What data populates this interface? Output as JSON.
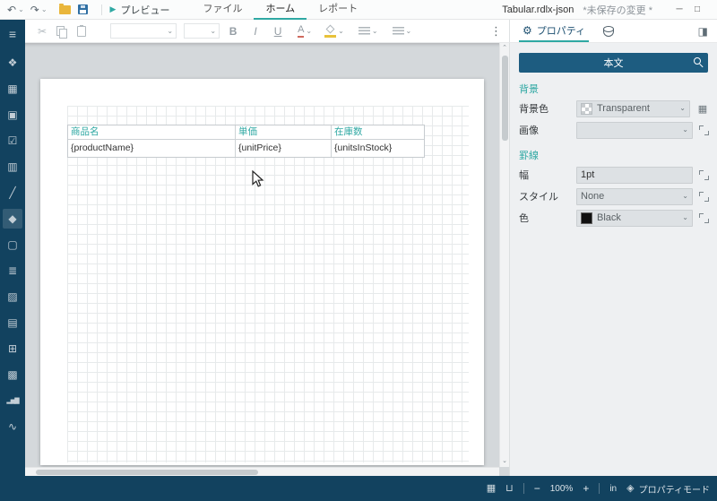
{
  "colors": {
    "accent_teal": "#2fa8a3",
    "sidebar_navy": "#12425f",
    "selector_blue": "#1d5c80",
    "canvas_gray": "#d4d8db",
    "save_blue": "#2f6fa3",
    "folder_yellow": "#e9b63b",
    "swatch_black": "#111111"
  },
  "glyphs": {
    "undo": "↶",
    "redo": "↷",
    "caret": "⌄",
    "play": "▶",
    "scissors": "✂",
    "dots": "⋮",
    "gear": "⚙",
    "panel_right": "◨",
    "minimize": "─",
    "maximize": "□",
    "grid_small": "▦",
    "page_view": "⊔",
    "layers": "◈",
    "scroll_up": "⌃",
    "scroll_down": "⌄"
  },
  "titlebar": {
    "preview_label": "プレビュー",
    "tabs": [
      {
        "label": "ファイル"
      },
      {
        "label": "ホーム",
        "active": true
      },
      {
        "label": "レポート"
      }
    ],
    "document_name": "Tabular.rdlx-json",
    "unsaved_indicator": "*未保存の変更 *"
  },
  "toolbar": {
    "bold": "B",
    "italic": "I",
    "underline": "U",
    "font_color": "A"
  },
  "panel_header": {
    "properties_tab": "プロパティ"
  },
  "sidebar": {
    "items": [
      {
        "name": "hamburger-menu-icon",
        "glyph": "≡"
      },
      {
        "name": "toolbox-shape-icon",
        "glyph": "❖"
      },
      {
        "name": "toolbox-tablix-icon",
        "glyph": "▦"
      },
      {
        "name": "toolbox-image-icon",
        "glyph": "▣"
      },
      {
        "name": "toolbox-checkbox-icon",
        "glyph": "☑"
      },
      {
        "name": "toolbox-barcode-icon",
        "glyph": "▥"
      },
      {
        "name": "toolbox-line-icon",
        "glyph": "╱"
      },
      {
        "name": "toolbox-ellipse-icon",
        "glyph": "◆"
      },
      {
        "name": "toolbox-container-icon",
        "glyph": "▢"
      },
      {
        "name": "toolbox-textbox-icon",
        "glyph": "≣"
      },
      {
        "name": "toolbox-richtext-icon",
        "glyph": "▨"
      },
      {
        "name": "toolbox-list-icon",
        "glyph": "▤"
      },
      {
        "name": "toolbox-table-icon",
        "glyph": "⊞"
      },
      {
        "name": "toolbox-matrix-icon",
        "glyph": "▩"
      },
      {
        "name": "toolbox-chart-icon",
        "glyph": "▂▅▇"
      },
      {
        "name": "toolbox-sparkline-icon",
        "glyph": "∿"
      }
    ]
  },
  "canvas": {
    "table": {
      "headers": [
        "商品名",
        "単価",
        "在庫数"
      ],
      "cells": [
        "{productName}",
        "{unitPrice}",
        "{unitsInStock}"
      ]
    }
  },
  "properties": {
    "selector_label": "本文",
    "sections": [
      {
        "title": "背景",
        "fields": [
          {
            "label": "背景色",
            "value": "Transparent"
          },
          {
            "label": "画像",
            "value": ""
          }
        ]
      },
      {
        "title": "罫線",
        "fields": [
          {
            "label": "幅",
            "value": "1pt"
          },
          {
            "label": "スタイル",
            "value": "None"
          },
          {
            "label": "色",
            "value": "Black"
          }
        ]
      }
    ]
  },
  "statusbar": {
    "zoom_out": "−",
    "zoom_level": "100%",
    "zoom_in": "+",
    "unit": "in",
    "mode_label": "プロパティモード"
  }
}
